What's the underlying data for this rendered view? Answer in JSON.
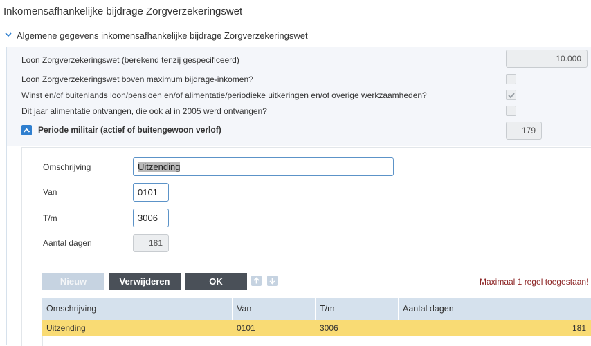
{
  "page": {
    "title": "Inkomensafhankelijke bijdrage Zorgverzekeringswet"
  },
  "section": {
    "title": "Algemene gegevens inkomensafhankelijke bijdrage Zorgverzekeringswet"
  },
  "general": {
    "loon_label": "Loon Zorgverzekeringswet (berekend tenzij gespecificeerd)",
    "loon_value": "10.000",
    "boven_max_label": "Loon Zorgverzekeringswet boven maximum bijdrage-inkomen?",
    "boven_max_checked": false,
    "winst_label": "Winst en/of buitenlands loon/pensioen en/of alimentatie/periodieke uitkeringen en/of overige werkzaamheden?",
    "winst_checked": true,
    "alimentatie_label": "Dit jaar alimentatie ontvangen, die ook al in 2005 werd ontvangen?",
    "alimentatie_checked": false,
    "militair_label": "Periode militair (actief of buitengewoon verlof)",
    "militair_value": "179"
  },
  "form": {
    "omschrijving_label": "Omschrijving",
    "omschrijving_value": "Uitzending",
    "van_label": "Van",
    "van_value": "0101",
    "tm_label": "T/m",
    "tm_value": "3006",
    "aantal_label": "Aantal dagen",
    "aantal_value": "181"
  },
  "buttons": {
    "nieuw": "Nieuw",
    "verwijderen": "Verwijderen",
    "ok": "OK"
  },
  "message": "Maximaal 1 regel toegestaan!",
  "grid": {
    "columns": [
      "Omschrijving",
      "Van",
      "T/m",
      "Aantal dagen"
    ],
    "rows": [
      {
        "omschrijving": "Uitzending",
        "van": "0101",
        "tm": "3006",
        "aantal": "181"
      }
    ]
  },
  "colors": {
    "accent": "#2f7fcf",
    "selected_row": "#f9db74",
    "grid_header": "#d5e1ed",
    "dark_button": "#4a5058",
    "message": "#8b2323"
  }
}
